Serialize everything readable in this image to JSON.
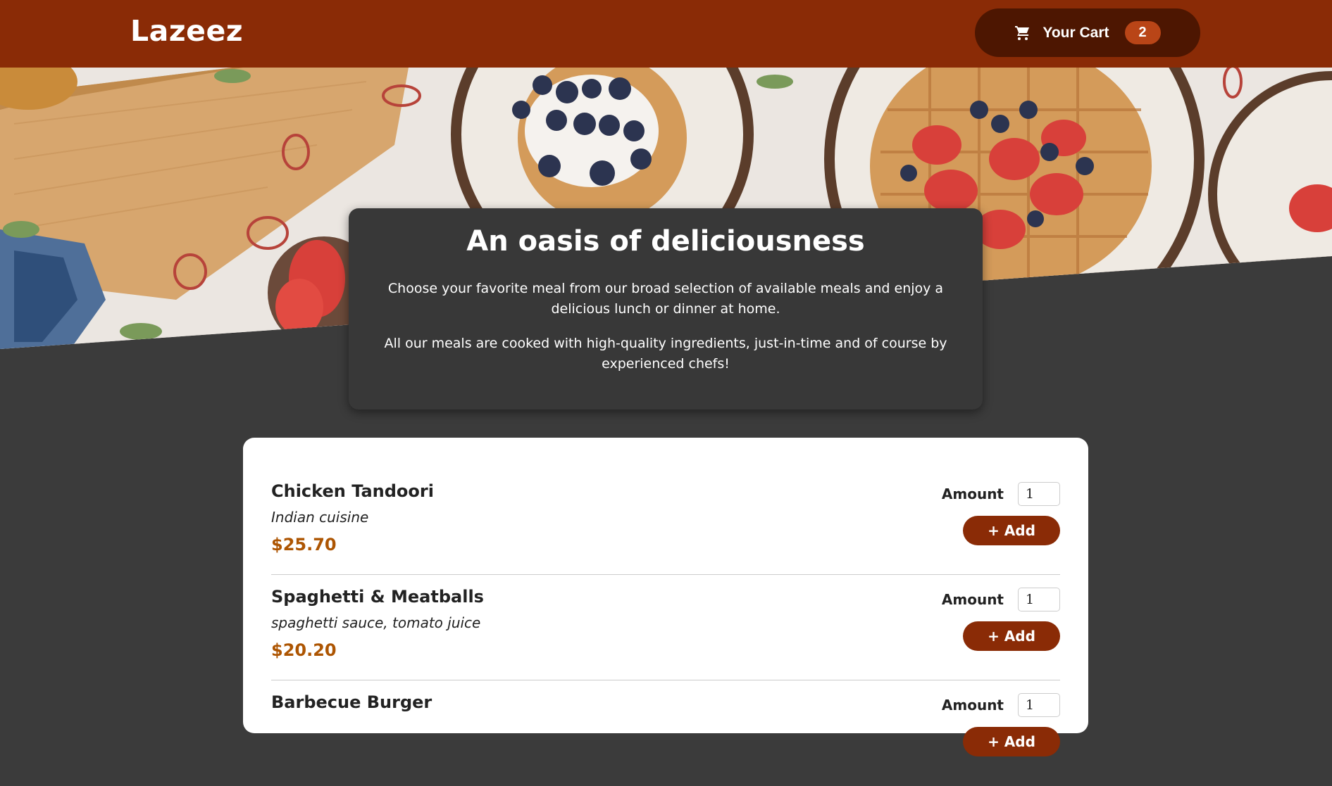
{
  "header": {
    "logo": "Lazeez",
    "cart_label": "Your Cart",
    "cart_count": "2",
    "cart_icon": "shopping-cart-icon"
  },
  "hero": {
    "image": "breakfast-table-photo"
  },
  "summary": {
    "title": "An oasis of deliciousness",
    "paragraph1": "Choose your favorite meal from our broad selection of available meals and enjoy a delicious lunch or dinner at home.",
    "paragraph2": "All our meals are cooked with high-quality ingredients, just-in-time and of course by experienced chefs!"
  },
  "meals": [
    {
      "name": "Chicken Tandoori",
      "description": "Indian cuisine",
      "price": "$25.70",
      "amount_label": "Amount",
      "amount_value": "1",
      "add_label": "+ Add"
    },
    {
      "name": "Spaghetti & Meatballs",
      "description": "spaghetti sauce, tomato juice",
      "price": "$20.20",
      "amount_label": "Amount",
      "amount_value": "1",
      "add_label": "+ Add"
    },
    {
      "name": "Barbecue Burger",
      "description": "",
      "price": "",
      "amount_label": "Amount",
      "amount_value": "1",
      "add_label": "+ Add"
    }
  ],
  "colors": {
    "brand": "#8a2b06",
    "cart_bg": "#4d1601",
    "badge": "#b94517",
    "price": "#ad5502",
    "page_bg": "#3b3b3b"
  }
}
